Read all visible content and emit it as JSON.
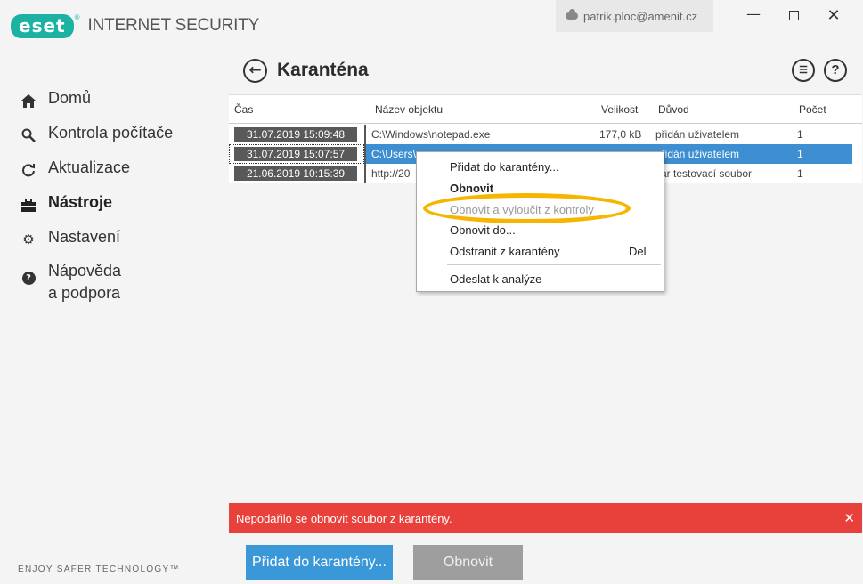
{
  "app": {
    "logo_text": "eset",
    "product_name": "INTERNET SECURITY",
    "account": "patrik.ploc@amenit.cz",
    "window_controls": {
      "minimize": "—",
      "maximize": "",
      "close": "✕"
    }
  },
  "sidebar": {
    "items": [
      {
        "label": "Domů",
        "icon": "home-icon"
      },
      {
        "label": "Kontrola počítače",
        "icon": "search-icon"
      },
      {
        "label": "Aktualizace",
        "icon": "refresh-icon"
      },
      {
        "label": "Nástroje",
        "icon": "toolbox-icon",
        "active": true
      },
      {
        "label": "Nastavení",
        "icon": "gear-icon"
      },
      {
        "label_line1": "Nápověda",
        "label_line2": "a podpora",
        "icon": "help-icon"
      }
    ],
    "tagline": "ENJOY SAFER TECHNOLOGY™"
  },
  "page": {
    "title": "Karanténa",
    "back_icon": "←",
    "list_icon": "☰",
    "help_icon": "?"
  },
  "table": {
    "columns": [
      "Čas",
      "Název objektu",
      "Velikost",
      "Důvod",
      "Počet"
    ],
    "rows": [
      {
        "time": "31.07.2019 15:09:48",
        "object": "C:\\Windows\\notepad.exe",
        "size": "177,0 kB",
        "reason": "přidán uživatelem",
        "count": "1"
      },
      {
        "time": "31.07.2019 15:07:57",
        "object": "C:\\Users\\",
        "size": "",
        "reason": "přidán uživatelem",
        "count": "1",
        "selected": true
      },
      {
        "time": "21.06.2019 10:15:39",
        "object": "http://20",
        "size": "",
        "reason": "car testovací soubor",
        "count": "1"
      }
    ]
  },
  "context_menu": {
    "items": [
      {
        "label": "Přidat do karantény...",
        "style": "normal"
      },
      {
        "label": "Obnovit",
        "style": "bold"
      },
      {
        "label": "Obnovit a vyloučit z kontroly",
        "style": "disabled"
      },
      {
        "label": "Obnovit do...",
        "style": "normal"
      },
      {
        "label": "Odstranit z karantény",
        "shortcut": "Del",
        "style": "normal"
      },
      {
        "label": "Odeslat k analýze",
        "style": "normal"
      }
    ],
    "highlight_color": "#f7b500"
  },
  "error_bar": {
    "message": "Nepodařilo se obnovit soubor z karantény.",
    "close": "✕",
    "color": "#e8413c"
  },
  "buttons": {
    "add": "Přidat do karantény...",
    "restore": "Obnovit"
  },
  "colors": {
    "brand": "#1bb1a3",
    "selection": "#3d8fd1",
    "primary_button": "#3b98d8"
  }
}
